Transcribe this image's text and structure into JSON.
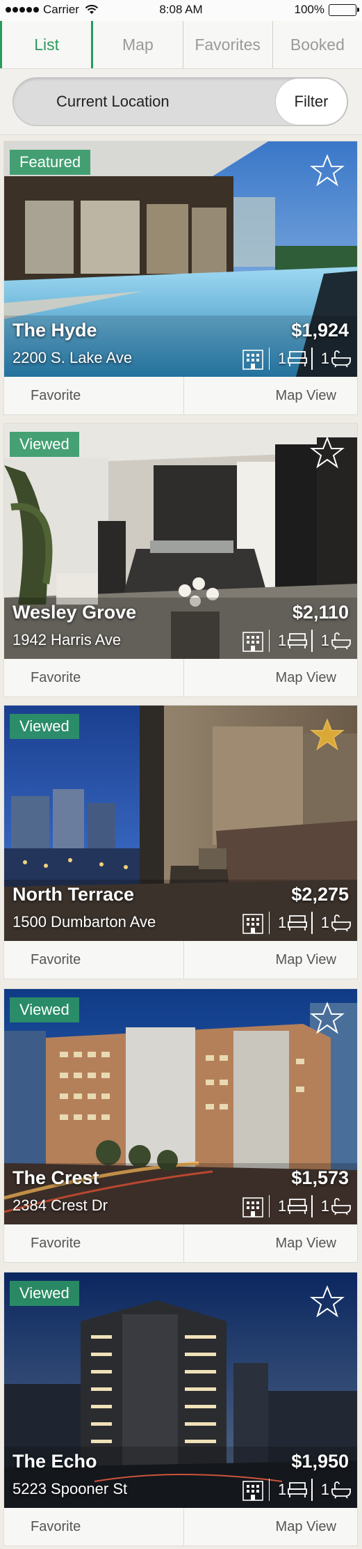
{
  "status_bar": {
    "carrier": "Carrier",
    "time": "8:08 AM",
    "battery": "100%"
  },
  "tabs": [
    {
      "label": "List",
      "active": true
    },
    {
      "label": "Map",
      "active": false
    },
    {
      "label": "Favorites",
      "active": false
    },
    {
      "label": "Booked",
      "active": false
    }
  ],
  "search": {
    "location_label": "Current Location",
    "filter_label": "Filter"
  },
  "colors": {
    "accent": "#2b9a5f",
    "badge": "#2e9664",
    "star_active": "#d9a836"
  },
  "listings": [
    {
      "badge": "Featured",
      "name": "The Hyde",
      "address": "2200 S. Lake Ave",
      "price": "$1,924",
      "beds": "1",
      "baths": "1",
      "favorited": false,
      "favorite_label": "Favorite",
      "map_label": "Map View"
    },
    {
      "badge": "Viewed",
      "name": "Wesley Grove",
      "address": "1942 Harris Ave",
      "price": "$2,110",
      "beds": "1",
      "baths": "1",
      "favorited": false,
      "favorite_label": "Favorite",
      "map_label": "Map View"
    },
    {
      "badge": "Viewed",
      "name": "North Terrace",
      "address": "1500 Dumbarton Ave",
      "price": "$2,275",
      "beds": "1",
      "baths": "1",
      "favorited": true,
      "favorite_label": "Favorite",
      "map_label": "Map View"
    },
    {
      "badge": "Viewed",
      "name": "The Crest",
      "address": "2384 Crest Dr",
      "price": "$1,573",
      "beds": "1",
      "baths": "1",
      "favorited": false,
      "favorite_label": "Favorite",
      "map_label": "Map View"
    },
    {
      "badge": "Viewed",
      "name": "The Echo",
      "address": "5223 Spooner St",
      "price": "$1,950",
      "beds": "1",
      "baths": "1",
      "favorited": false,
      "favorite_label": "Favorite",
      "map_label": "Map View"
    }
  ]
}
